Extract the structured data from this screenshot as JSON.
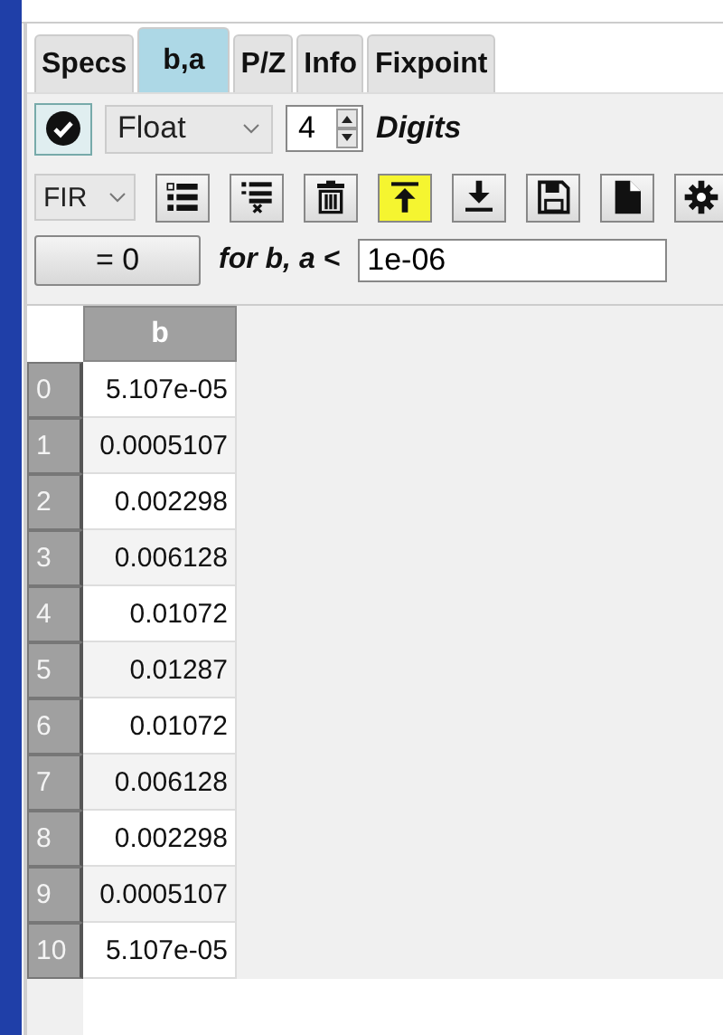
{
  "tabs": [
    {
      "label": "Specs",
      "selected": false
    },
    {
      "label": "b,a",
      "selected": true
    },
    {
      "label": "P/Z",
      "selected": false
    },
    {
      "label": "Info",
      "selected": false
    },
    {
      "label": "Fixpoint",
      "selected": false
    }
  ],
  "format_row": {
    "toggle": {
      "checked": true
    },
    "format": "Float",
    "digits": "4",
    "digits_label": "Digits"
  },
  "toolbar": {
    "filter_type": "FIR",
    "buttons": [
      {
        "kind": "list",
        "highlighted": false
      },
      {
        "kind": "delete-row",
        "highlighted": false
      },
      {
        "kind": "trash",
        "highlighted": false
      },
      {
        "kind": "upload",
        "highlighted": true
      },
      {
        "kind": "download",
        "highlighted": false
      },
      {
        "kind": "save",
        "highlighted": false
      },
      {
        "kind": "file",
        "highlighted": false
      },
      {
        "kind": "settings",
        "highlighted": false
      }
    ]
  },
  "zero_row": {
    "button": "= 0",
    "label": "for b, a <",
    "threshold": "1e-06"
  },
  "table": {
    "columns": [
      "b"
    ],
    "rows": [
      {
        "index": "0",
        "value": "5.107e-05"
      },
      {
        "index": "1",
        "value": "0.0005107"
      },
      {
        "index": "2",
        "value": "0.002298"
      },
      {
        "index": "3",
        "value": "0.006128"
      },
      {
        "index": "4",
        "value": "0.01072"
      },
      {
        "index": "5",
        "value": "0.01287"
      },
      {
        "index": "6",
        "value": "0.01072"
      },
      {
        "index": "7",
        "value": "0.006128"
      },
      {
        "index": "8",
        "value": "0.002298"
      },
      {
        "index": "9",
        "value": "0.0005107"
      },
      {
        "index": "10",
        "value": "5.107e-05"
      }
    ]
  }
}
